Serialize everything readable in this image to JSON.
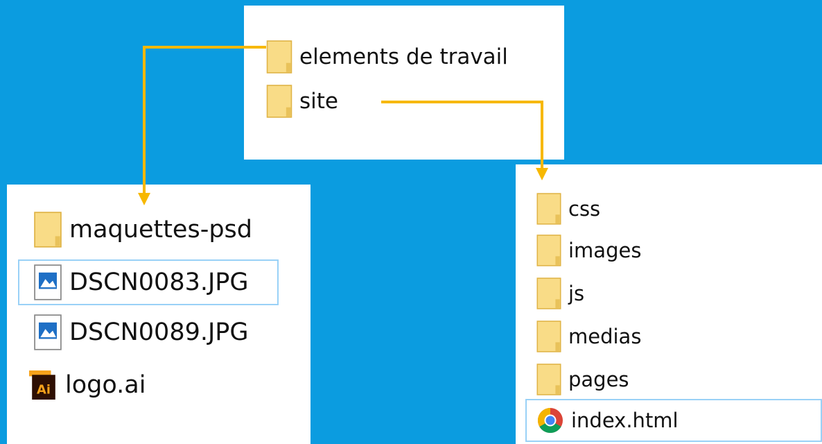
{
  "colors": {
    "background": "#0b9ce0",
    "panel": "#ffffff",
    "arrow": "#f7b800",
    "selection_border": "#99d1f7",
    "folder": "#f9dc87",
    "folder_edge": "#e0b447",
    "ai_dark": "#2e0f03",
    "ai_orange": "#f7a21b"
  },
  "top_panel": {
    "items": [
      {
        "label": "elements de travail",
        "icon": "folder-icon"
      },
      {
        "label": "site",
        "icon": "folder-icon"
      }
    ]
  },
  "left_panel": {
    "items": [
      {
        "label": "maquettes-psd",
        "icon": "folder-icon"
      },
      {
        "label": "DSCN0083.JPG",
        "icon": "image-file-icon",
        "selected": true
      },
      {
        "label": "DSCN0089.JPG",
        "icon": "image-file-icon"
      },
      {
        "label": "logo.ai",
        "icon": "illustrator-file-icon",
        "icon_text": "Ai"
      }
    ]
  },
  "right_panel": {
    "items": [
      {
        "label": "css",
        "icon": "folder-icon"
      },
      {
        "label": "images",
        "icon": "folder-icon"
      },
      {
        "label": "js",
        "icon": "folder-icon"
      },
      {
        "label": "medias",
        "icon": "folder-icon"
      },
      {
        "label": "pages",
        "icon": "folder-icon"
      },
      {
        "label": "index.html",
        "icon": "chrome-html-icon",
        "selected": true
      }
    ]
  }
}
